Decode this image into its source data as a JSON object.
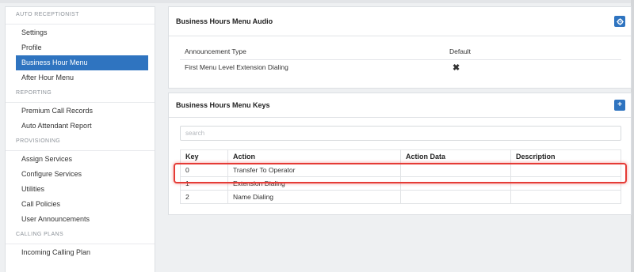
{
  "sidebar": {
    "sections": [
      {
        "title": "AUTO RECEPTIONIST",
        "items": [
          "Settings",
          "Profile",
          "Business Hour Menu",
          "After Hour Menu"
        ]
      },
      {
        "title": "REPORTING",
        "items": [
          "Premium Call Records",
          "Auto Attendant Report"
        ]
      },
      {
        "title": "PROVISIONING",
        "items": [
          "Assign Services",
          "Configure Services",
          "Utilities",
          "Call Policies",
          "User Announcements"
        ]
      },
      {
        "title": "CALLING PLANS",
        "items": [
          "Incoming Calling Plan"
        ]
      }
    ],
    "active_item": "Business Hour Menu"
  },
  "audio_panel": {
    "title": "Business Hours Menu Audio",
    "rows": [
      {
        "label": "Announcement Type",
        "value": "Default"
      },
      {
        "label": "First Menu Level Extension Dialing",
        "value": "✖"
      }
    ],
    "button_icon": "gear-icon"
  },
  "keys_panel": {
    "title": "Business Hours Menu Keys",
    "button_icon": "plus-icon",
    "search_placeholder": "search",
    "columns": [
      "Key",
      "Action",
      "Action Data",
      "Description"
    ],
    "rows": [
      [
        "0",
        "Transfer To Operator",
        "",
        ""
      ],
      [
        "1",
        "Extension Dialing",
        "",
        ""
      ],
      [
        "2",
        "Name Dialing",
        "",
        ""
      ]
    ]
  },
  "colors": {
    "accent": "#2f74c0",
    "highlight": "#e53b36"
  }
}
